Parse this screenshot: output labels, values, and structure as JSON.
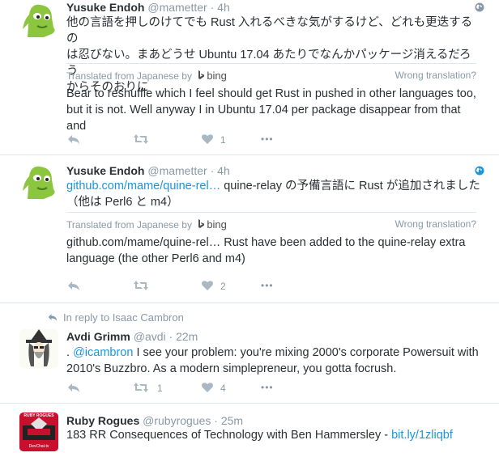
{
  "tweets": [
    {
      "name": "Yusuke Endoh",
      "handle": "@mametter",
      "time": "4h",
      "text_line1": "他の言語を押しのけてでも Rust 入れるべきな気がするけど、どれも更迭するの",
      "text_line2": "は忍びない。まあどうせ Ubuntu 17.04 あたりでなんかパッケージ消えるだろう",
      "text_line3": "からそのおりに",
      "translated_from": "Translated from Japanese by",
      "bing": "bing",
      "wrong_translation": "Wrong translation?",
      "translation_line1": "Bear to reshuffle which I feel should get Rust in pushed in other languages too,",
      "translation_line2": "but it is not. Well anyway I in Ubuntu 17.04 per package disappear from that and",
      "like_count": "1"
    },
    {
      "name": "Yusuke Endoh",
      "handle": "@mametter",
      "time": "4h",
      "link_text": "github.com/mame/quine-rel…",
      "text_line1_rest": " quine-relay の予備言語に Rust が追加されました",
      "text_line2": "（他は Perl6 と m4）",
      "translated_from": "Translated from Japanese by",
      "bing": "bing",
      "wrong_translation": "Wrong translation?",
      "translation_line1": "github.com/mame/quine-rel… Rust have been added to the quine-relay extra",
      "translation_line2": "language (the other Perl6 and m4)",
      "like_count": "2"
    },
    {
      "reply_context": "In reply to Isaac Cambron",
      "name": "Avdi Grimm",
      "handle": "@avdi",
      "time": "22m",
      "text_prefix": ". ",
      "mention": "@icambron",
      "text_line1_rest": " I see your problem: you're mixing 2000's corporate Powersuit with",
      "text_line2": "2010's Buzzbro. As a modern simplepreneur, you gotta focrush.",
      "retweet_count": "1",
      "like_count": "4"
    },
    {
      "name": "Ruby Rogues",
      "handle": "@rubyrogues",
      "time": "25m",
      "text": "183 RR Consequences of Technology with Ben Hammersley - ",
      "link_text": "bit.ly/1zliqbf",
      "avatar_caption_top": "RUBY ROGUES",
      "avatar_caption_bottom": "DevChat.tv"
    }
  ],
  "dot": "·",
  "more": "•••",
  "colors": {
    "link": "#1b95e0",
    "meta": "#8899a6",
    "text": "#292f33",
    "avatar_green": "#8cc63f"
  }
}
